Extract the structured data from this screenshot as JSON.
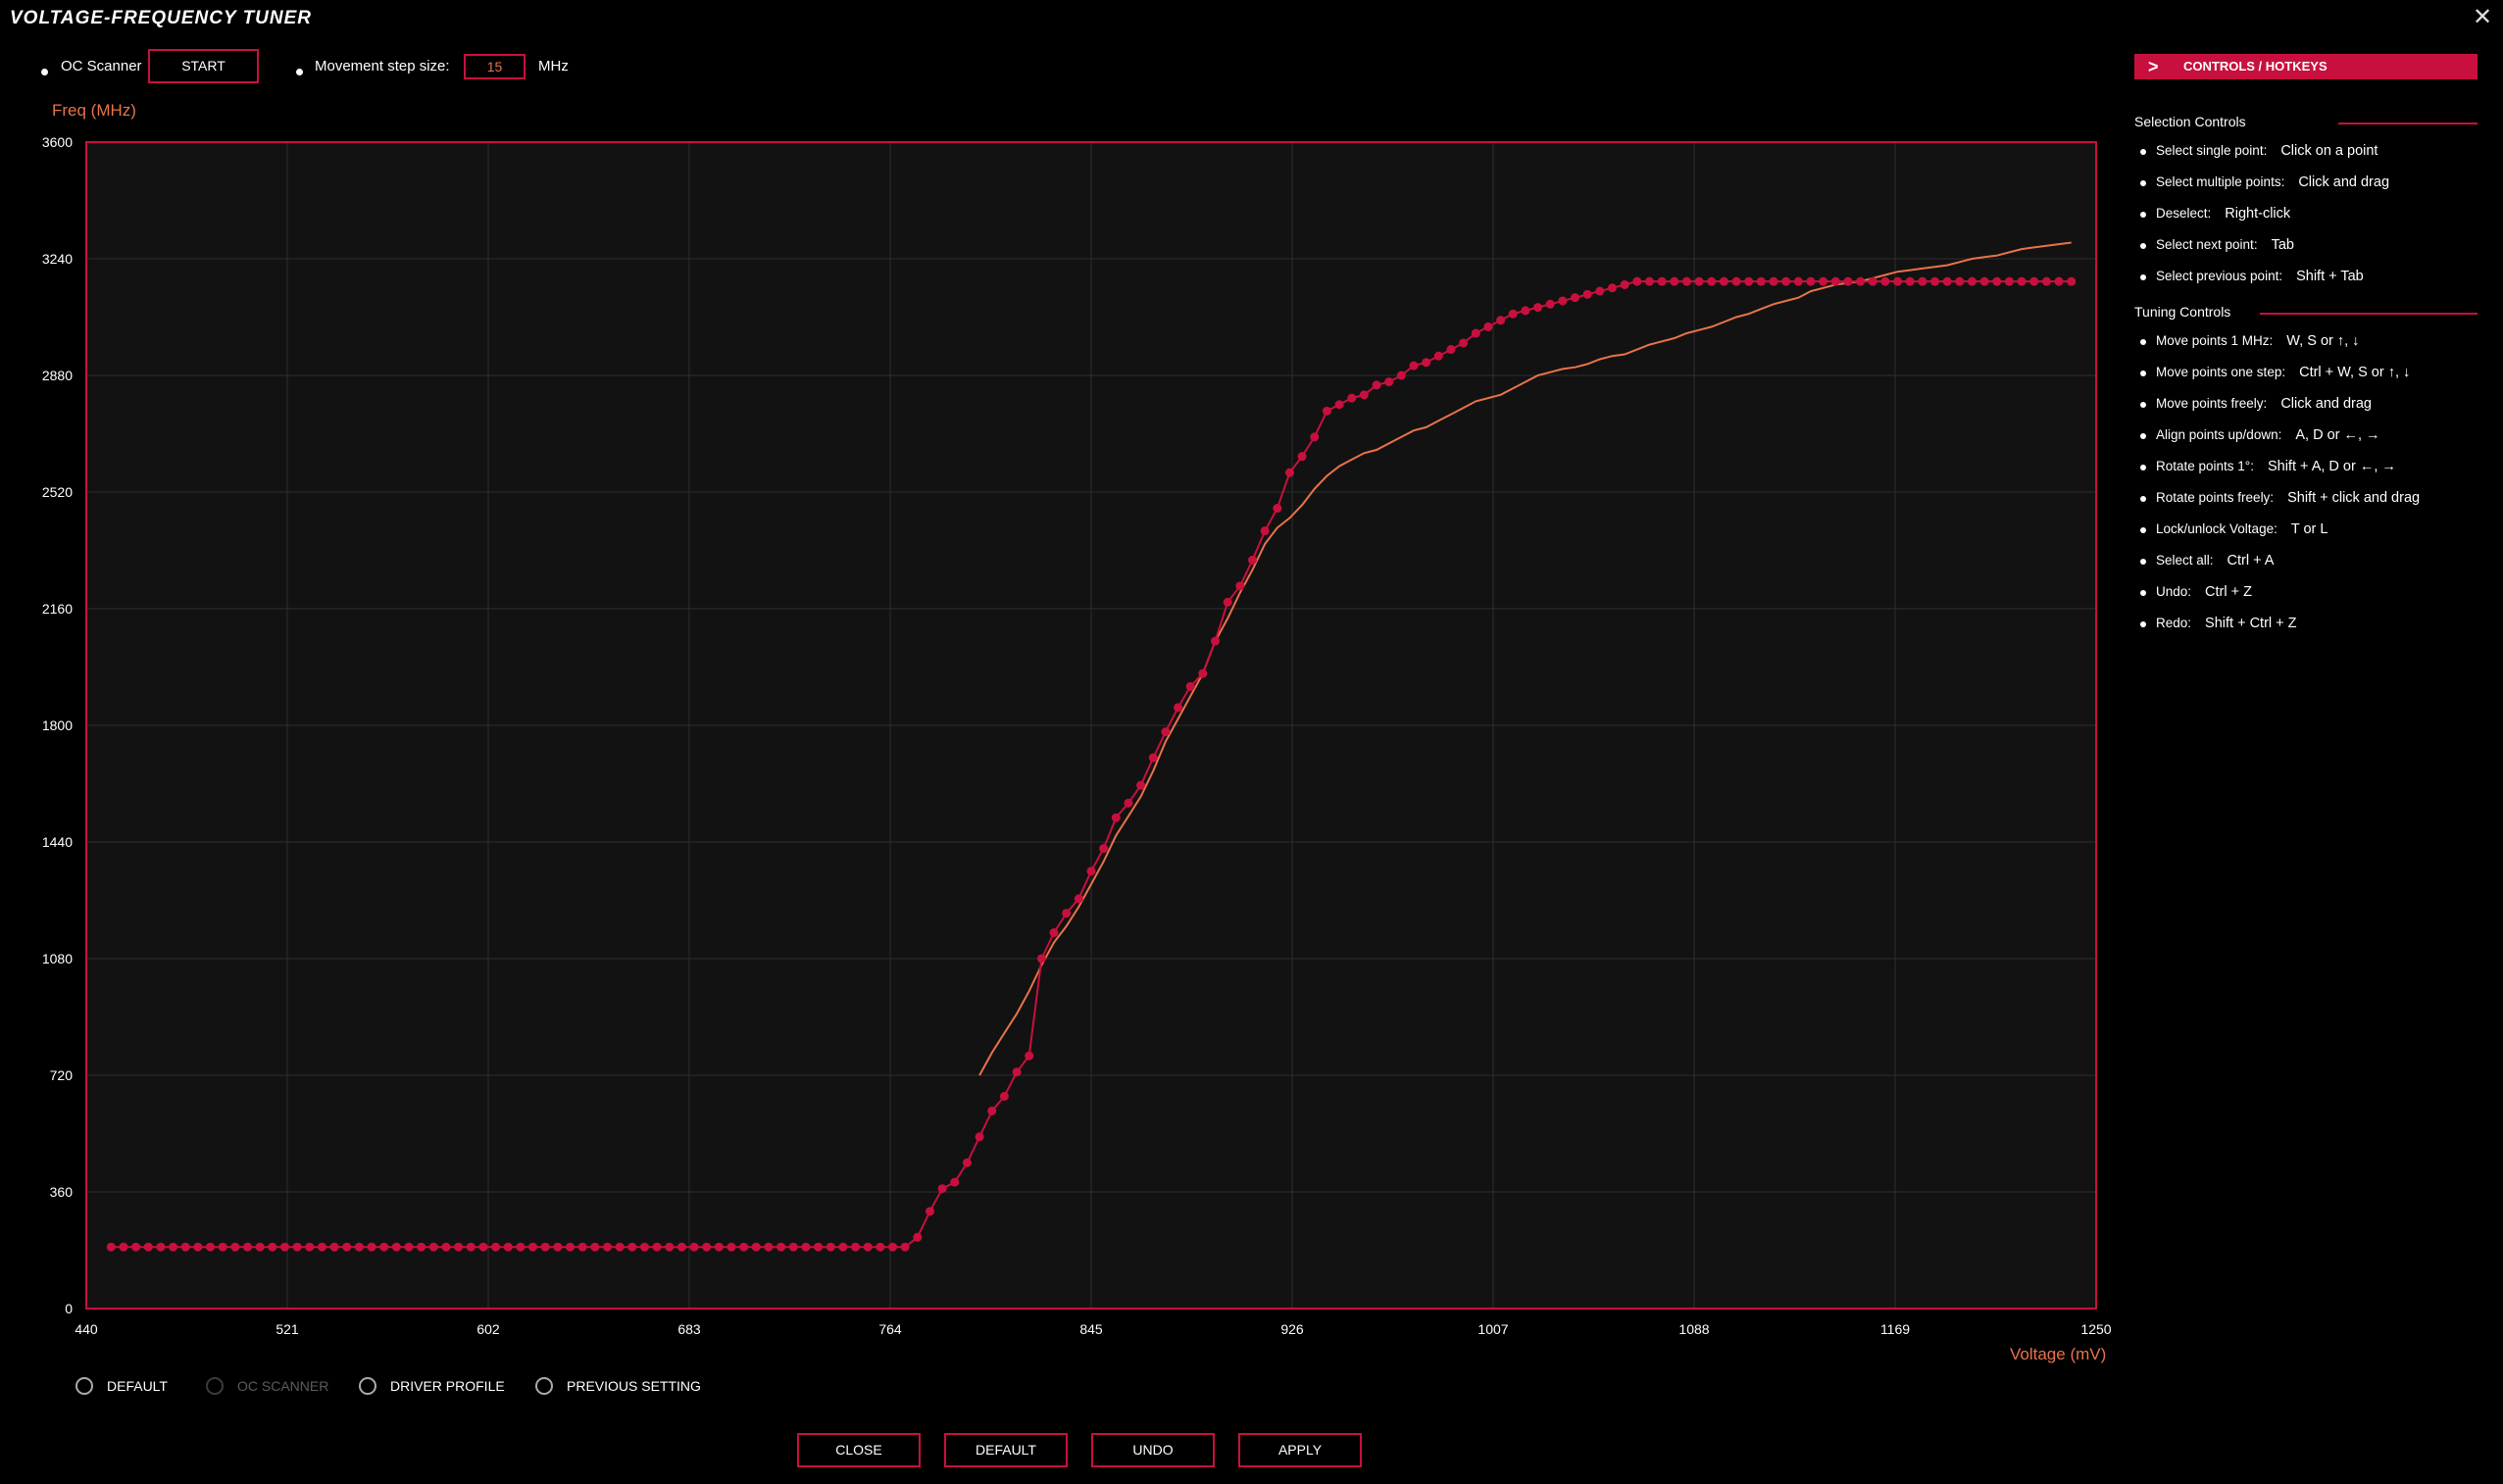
{
  "window": {
    "title": "VOLTAGE-FREQUENCY TUNER",
    "close_glyph": "✕"
  },
  "toolbar": {
    "oc_scanner_label": "OC Scanner",
    "start_label": "START",
    "step_label": "Movement step size:",
    "step_value": "15",
    "step_unit": "MHz"
  },
  "colors": {
    "accent": "#c8103e",
    "orange": "#e8734a",
    "plot_bg": "#121212"
  },
  "chart_data": {
    "type": "line",
    "ylabel": "Freq (MHz)",
    "xlabel": "Voltage (mV)",
    "xlim": [
      440,
      1250
    ],
    "ylim": [
      0,
      3600
    ],
    "x_ticks": [
      "440",
      "521",
      "602",
      "683",
      "764",
      "845",
      "926",
      "1007",
      "1088",
      "1169",
      "1250"
    ],
    "y_ticks": [
      "0",
      "360",
      "720",
      "1080",
      "1440",
      "1800",
      "2160",
      "2520",
      "2880",
      "3240",
      "3600"
    ],
    "grid": true,
    "series": [
      {
        "color": "#c8103e",
        "markers": true,
        "x": [
          450,
          455,
          460,
          465,
          470,
          475,
          480,
          485,
          490,
          495,
          500,
          505,
          510,
          515,
          520,
          525,
          530,
          535,
          540,
          545,
          550,
          555,
          560,
          565,
          570,
          575,
          580,
          585,
          590,
          595,
          600,
          605,
          610,
          615,
          620,
          625,
          630,
          635,
          640,
          645,
          650,
          655,
          660,
          665,
          670,
          675,
          680,
          685,
          690,
          695,
          700,
          705,
          710,
          715,
          720,
          725,
          730,
          735,
          740,
          745,
          750,
          755,
          760,
          765,
          770,
          775,
          780,
          785,
          790,
          795,
          800,
          805,
          810,
          815,
          820,
          825,
          830,
          835,
          840,
          845,
          850,
          855,
          860,
          865,
          870,
          875,
          880,
          885,
          890,
          895,
          900,
          905,
          910,
          915,
          920,
          925,
          930,
          935,
          940,
          945,
          950,
          955,
          960,
          965,
          970,
          975,
          980,
          985,
          990,
          995,
          1000,
          1005,
          1010,
          1015,
          1020,
          1025,
          1030,
          1035,
          1040,
          1045,
          1050,
          1055,
          1060,
          1065,
          1070,
          1075,
          1080,
          1085,
          1090,
          1095,
          1100,
          1105,
          1110,
          1115,
          1120,
          1125,
          1130,
          1135,
          1140,
          1145,
          1150,
          1155,
          1160,
          1165,
          1170,
          1175,
          1180,
          1185,
          1190,
          1195,
          1200,
          1205,
          1210,
          1215,
          1220,
          1225,
          1230,
          1235,
          1240
        ],
        "y": [
          190,
          190,
          190,
          190,
          190,
          190,
          190,
          190,
          190,
          190,
          190,
          190,
          190,
          190,
          190,
          190,
          190,
          190,
          190,
          190,
          190,
          190,
          190,
          190,
          190,
          190,
          190,
          190,
          190,
          190,
          190,
          190,
          190,
          190,
          190,
          190,
          190,
          190,
          190,
          190,
          190,
          190,
          190,
          190,
          190,
          190,
          190,
          190,
          190,
          190,
          190,
          190,
          190,
          190,
          190,
          190,
          190,
          190,
          190,
          190,
          190,
          190,
          190,
          190,
          190,
          220,
          300,
          370,
          390,
          450,
          530,
          610,
          655,
          730,
          780,
          1080,
          1160,
          1220,
          1265,
          1350,
          1420,
          1515,
          1560,
          1615,
          1700,
          1780,
          1855,
          1920,
          1960,
          2060,
          2180,
          2230,
          2310,
          2400,
          2470,
          2580,
          2630,
          2690,
          2770,
          2790,
          2810,
          2820,
          2850,
          2860,
          2880,
          2910,
          2920,
          2940,
          2960,
          2980,
          3010,
          3030,
          3050,
          3070,
          3080,
          3090,
          3100,
          3110,
          3120,
          3130,
          3140,
          3150,
          3160,
          3170,
          3170,
          3170,
          3170,
          3170,
          3170,
          3170,
          3170,
          3170,
          3170,
          3170,
          3170,
          3170,
          3170,
          3170,
          3170,
          3170,
          3170,
          3170,
          3170,
          3170,
          3170,
          3170,
          3170,
          3170,
          3170,
          3170,
          3170,
          3170,
          3170,
          3170,
          3170,
          3170,
          3170,
          3170,
          3170
        ]
      },
      {
        "color": "#e8734a",
        "markers": false,
        "x": [
          800,
          805,
          810,
          815,
          820,
          825,
          830,
          835,
          840,
          845,
          850,
          855,
          860,
          865,
          870,
          875,
          880,
          885,
          890,
          895,
          900,
          905,
          910,
          915,
          920,
          925,
          930,
          935,
          940,
          945,
          950,
          955,
          960,
          965,
          970,
          975,
          980,
          985,
          990,
          995,
          1000,
          1005,
          1010,
          1015,
          1020,
          1025,
          1030,
          1035,
          1040,
          1045,
          1050,
          1055,
          1060,
          1065,
          1070,
          1075,
          1080,
          1085,
          1090,
          1095,
          1100,
          1105,
          1110,
          1115,
          1120,
          1125,
          1130,
          1135,
          1140,
          1145,
          1150,
          1155,
          1160,
          1165,
          1170,
          1175,
          1180,
          1185,
          1190,
          1195,
          1200,
          1205,
          1210,
          1215,
          1220,
          1225,
          1230,
          1235,
          1240
        ],
        "y": [
          720,
          790,
          850,
          910,
          980,
          1060,
          1130,
          1180,
          1240,
          1310,
          1380,
          1460,
          1520,
          1580,
          1660,
          1750,
          1820,
          1890,
          1960,
          2060,
          2130,
          2210,
          2280,
          2360,
          2410,
          2440,
          2480,
          2530,
          2570,
          2600,
          2620,
          2640,
          2650,
          2670,
          2690,
          2710,
          2720,
          2740,
          2760,
          2780,
          2800,
          2810,
          2820,
          2840,
          2860,
          2880,
          2890,
          2900,
          2905,
          2915,
          2930,
          2940,
          2945,
          2960,
          2975,
          2985,
          2995,
          3010,
          3020,
          3030,
          3045,
          3060,
          3070,
          3085,
          3100,
          3110,
          3120,
          3140,
          3150,
          3160,
          3165,
          3170,
          3180,
          3190,
          3200,
          3205,
          3210,
          3215,
          3220,
          3230,
          3240,
          3245,
          3250,
          3260,
          3270,
          3275,
          3280,
          3285,
          3290
        ]
      }
    ]
  },
  "profiles": [
    {
      "label": "DEFAULT",
      "enabled": true
    },
    {
      "label": "OC SCANNER",
      "enabled": false
    },
    {
      "label": "DRIVER PROFILE",
      "enabled": true
    },
    {
      "label": "PREVIOUS SETTING",
      "enabled": true
    }
  ],
  "buttons": {
    "close": "CLOSE",
    "default": "DEFAULT",
    "undo": "UNDO",
    "apply": "APPLY"
  },
  "panel": {
    "header": "CONTROLS / HOTKEYS",
    "selection_title": "Selection Controls",
    "selection": [
      {
        "label": "Select single point:",
        "action": "Click on a point"
      },
      {
        "label": "Select multiple points:",
        "action": "Click and drag"
      },
      {
        "label": "Deselect:",
        "action": "Right-click"
      },
      {
        "label": "Select next point:",
        "action": "Tab"
      },
      {
        "label": "Select previous point:",
        "action": "Shift + Tab"
      }
    ],
    "tuning_title": "Tuning Controls",
    "tuning": [
      {
        "label": "Move points 1 MHz:",
        "action": "W, S or ↑, ↓"
      },
      {
        "label": "Move points one step:",
        "action": "Ctrl + W, S or ↑, ↓"
      },
      {
        "label": "Move points freely:",
        "action": "Click and drag"
      },
      {
        "label": "Align points up/down:",
        "action": "A, D or ←, →"
      },
      {
        "label": "Rotate points 1°:",
        "action": "Shift + A, D or ←, →"
      },
      {
        "label": "Rotate points freely:",
        "action": "Shift + click and drag"
      },
      {
        "label": "Lock/unlock Voltage:",
        "action": "T or L"
      },
      {
        "label": "Select all:",
        "action": "Ctrl + A"
      },
      {
        "label": "Undo:",
        "action": "Ctrl + Z"
      },
      {
        "label": "Redo:",
        "action": "Shift + Ctrl + Z"
      }
    ]
  }
}
